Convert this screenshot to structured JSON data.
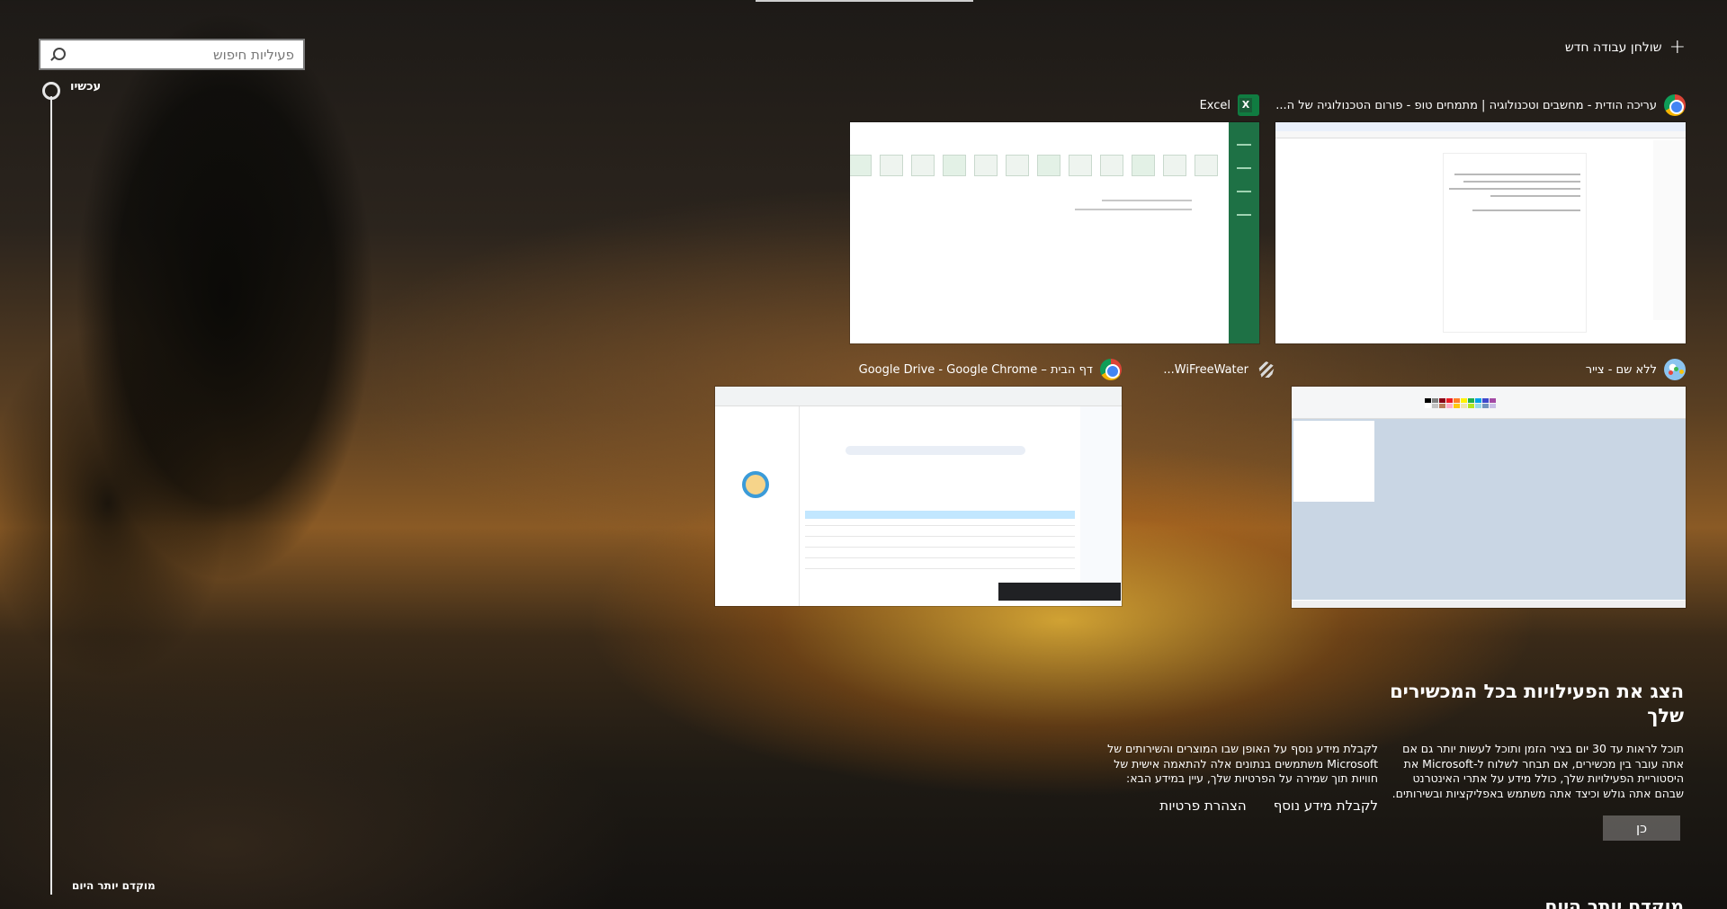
{
  "search": {
    "placeholder": "פעיליות חיפוש"
  },
  "timeline": {
    "now_label": "עכשיו",
    "earlier_label": "מוקדם יותר היום"
  },
  "new_desktop": {
    "label": "שולחן עבודה חדש"
  },
  "windows": [
    {
      "title": "עריכה הודית - מחשבים וטכנולוגיה | מתמחים טופ - פורום הטכנולוגיה של ה...",
      "icon": "chrome-icon"
    },
    {
      "title": "Excel",
      "icon": "excel-icon"
    },
    {
      "title": "ללא שם - צייר",
      "icon": "paint-icon"
    },
    {
      "title": "WiFreeWater...",
      "icon": "wifiwater-icon"
    },
    {
      "title": "דף הבית – Google Drive - Google Chrome",
      "icon": "chrome-icon"
    }
  ],
  "promo": {
    "title": "הצג את הפעילויות בכל המכשירים שלך",
    "body": "תוכל לראות עד 30 יום בציר הזמן ותוכל לעשות יותר גם אם אתה עובר בין מכשירים, אם תבחר לשלוח ל-Microsoft את היסטוריית הפעילויות שלך, כולל מידע על אתרי האינטרנט שבהם אתה גולש וכיצד אתה משתמש באפליקציות ובשירותים.",
    "privacy_text": "לקבלת מידע נוסף על האופן שבו המוצרים והשירותים של Microsoft משתמשים בנתונים אלה להתאמה אישית של חוויות תוך שמירה על הפרטיות שלך, עיין במידע הבא:",
    "learn_more": "לקבלת מידע נוסף",
    "privacy_statement": "הצהרת פרטיות",
    "yes_button": "כן"
  },
  "earlier_today_heading": "מוקדם יותר היום",
  "colors": {
    "excel_green": "#1e7145",
    "timeline": "#e6e6e6"
  }
}
